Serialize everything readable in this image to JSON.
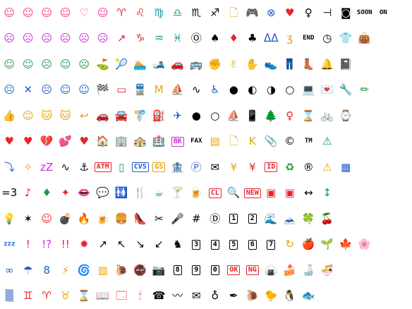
{
  "grid": {
    "cols": 22,
    "rows": 12,
    "icons": [
      {
        "glyph": "☺",
        "color": "#ff2d8e"
      },
      {
        "glyph": "☺",
        "color": "#ff2d8e"
      },
      {
        "glyph": "☺",
        "color": "#ff2d8e"
      },
      {
        "glyph": "☺",
        "color": "#ff2d8e"
      },
      {
        "glyph": "♡",
        "color": "#ff2d8e"
      },
      {
        "glyph": "☺",
        "color": "#ff2d8e"
      },
      {
        "glyph": "♈",
        "color": "#e5242b"
      },
      {
        "glyph": "♌",
        "color": "#e5242b"
      },
      {
        "glyph": "♍",
        "color": "#1a9a9a"
      },
      {
        "glyph": "♎",
        "color": "#1a9a9a"
      },
      {
        "glyph": "♏",
        "color": "#000000"
      },
      {
        "glyph": "♐",
        "color": "#000000"
      },
      {
        "glyph": "🗋",
        "color": "#e8a400"
      },
      {
        "glyph": "🎮",
        "color": "#000000"
      },
      {
        "glyph": "⊗",
        "color": "#1f5cc9"
      },
      {
        "glyph": "♥",
        "color": "#e5242b"
      },
      {
        "glyph": "♀",
        "color": "#000000"
      },
      {
        "glyph": "⊣",
        "color": "#000000"
      },
      {
        "glyph": "◙",
        "color": "#000000"
      },
      {
        "glyph": "SOON",
        "color": "#000000",
        "kind": "small"
      },
      {
        "glyph": "ON",
        "color": "#000000",
        "kind": "small"
      },
      {
        "glyph": "",
        "color": "#000000"
      },
      {
        "glyph": "☹",
        "color": "#c42fd6"
      },
      {
        "glyph": "☹",
        "color": "#c42fd6"
      },
      {
        "glyph": "☹",
        "color": "#c42fd6"
      },
      {
        "glyph": "☹",
        "color": "#c42fd6"
      },
      {
        "glyph": "☹",
        "color": "#c42fd6"
      },
      {
        "glyph": "☹",
        "color": "#c42fd6"
      },
      {
        "glyph": "↗",
        "color": "#e5242b"
      },
      {
        "glyph": "♑",
        "color": "#e5242b"
      },
      {
        "glyph": "♒",
        "color": "#1a9a9a"
      },
      {
        "glyph": "♓",
        "color": "#1a9a9a"
      },
      {
        "glyph": "Ⓞ",
        "color": "#000000"
      },
      {
        "glyph": "♠",
        "color": "#000000"
      },
      {
        "glyph": "♦",
        "color": "#e5242b"
      },
      {
        "glyph": "♣",
        "color": "#000000"
      },
      {
        "glyph": "ᐃᐃ",
        "color": "#1f5cc9"
      },
      {
        "glyph": "ʒ",
        "color": "#e8a400"
      },
      {
        "glyph": "END",
        "color": "#000000",
        "kind": "small"
      },
      {
        "glyph": "◷",
        "color": "#000000"
      },
      {
        "glyph": "👕",
        "color": "#1f5cc9"
      },
      {
        "glyph": "👜",
        "color": "#000000"
      },
      {
        "glyph": "",
        "color": "#000000"
      },
      {
        "glyph": "",
        "color": "#000000"
      },
      {
        "glyph": "☺",
        "color": "#1a9a40"
      },
      {
        "glyph": "☺",
        "color": "#1a9a40"
      },
      {
        "glyph": "☹",
        "color": "#1a9a40"
      },
      {
        "glyph": "☺",
        "color": "#1a9a40"
      },
      {
        "glyph": "☹",
        "color": "#1a9a40"
      },
      {
        "glyph": "⛳",
        "color": "#1a9a40"
      },
      {
        "glyph": "🎾",
        "color": "#1a9a40"
      },
      {
        "glyph": "🏊",
        "color": "#1f5cc9"
      },
      {
        "glyph": "🎿",
        "color": "#000000"
      },
      {
        "glyph": "🚗",
        "color": "#e8a400"
      },
      {
        "glyph": "🚌",
        "color": "#1f5cc9"
      },
      {
        "glyph": "✊",
        "color": "#e8a400"
      },
      {
        "glyph": "✌",
        "color": "#e8a400"
      },
      {
        "glyph": "✋",
        "color": "#e8a400"
      },
      {
        "glyph": "👟",
        "color": "#000000"
      },
      {
        "glyph": "👖",
        "color": "#1f5cc9"
      },
      {
        "glyph": "👢",
        "color": "#1f5cc9"
      },
      {
        "glyph": "🔔",
        "color": "#e8a400"
      },
      {
        "glyph": "📓",
        "color": "#e5242b"
      },
      {
        "glyph": "",
        "color": "#000000"
      },
      {
        "glyph": "",
        "color": "#000000"
      },
      {
        "glyph": "",
        "color": "#000000"
      },
      {
        "glyph": "☹",
        "color": "#1f5cc9"
      },
      {
        "glyph": "✕",
        "color": "#1f5cc9"
      },
      {
        "glyph": "☹",
        "color": "#1f5cc9"
      },
      {
        "glyph": "☺",
        "color": "#1f5cc9"
      },
      {
        "glyph": "☺",
        "color": "#1f5cc9"
      },
      {
        "glyph": "🏁",
        "color": "#000000"
      },
      {
        "glyph": "▭",
        "color": "#e5242b"
      },
      {
        "glyph": "🚆",
        "color": "#1a9a40"
      },
      {
        "glyph": "M",
        "color": "#e8a400"
      },
      {
        "glyph": "⛵",
        "color": "#1f5cc9"
      },
      {
        "glyph": "∿",
        "color": "#000000"
      },
      {
        "glyph": "♿",
        "color": "#1f5cc9"
      },
      {
        "glyph": "●",
        "color": "#000000"
      },
      {
        "glyph": "◐",
        "color": "#000000"
      },
      {
        "glyph": "◑",
        "color": "#000000"
      },
      {
        "glyph": "○",
        "color": "#000000"
      },
      {
        "glyph": "💻",
        "color": "#000000"
      },
      {
        "glyph": "💌",
        "color": "#e5242b"
      },
      {
        "glyph": "🔧",
        "color": "#1f5cc9"
      },
      {
        "glyph": "✏",
        "color": "#1a9a40"
      },
      {
        "glyph": "",
        "color": "#000000"
      },
      {
        "glyph": "",
        "color": "#000000"
      },
      {
        "glyph": "👍",
        "color": "#e8a400"
      },
      {
        "glyph": "☺",
        "color": "#e8a400"
      },
      {
        "glyph": "🐱",
        "color": "#e8a400"
      },
      {
        "glyph": "🐱",
        "color": "#e8a400"
      },
      {
        "glyph": "↩",
        "color": "#e8a400"
      },
      {
        "glyph": "🚗",
        "color": "#000000"
      },
      {
        "glyph": "🚘",
        "color": "#1a9a40"
      },
      {
        "glyph": "🚏",
        "color": "#e5242b"
      },
      {
        "glyph": "⛽",
        "color": "#1f5cc9"
      },
      {
        "glyph": "✈",
        "color": "#1f5cc9"
      },
      {
        "glyph": "●",
        "color": "#000000"
      },
      {
        "glyph": "○",
        "color": "#000000"
      },
      {
        "glyph": "⛵",
        "color": "#1f5cc9"
      },
      {
        "glyph": "📱",
        "color": "#000000"
      },
      {
        "glyph": "🌲",
        "color": "#1a9a40"
      },
      {
        "glyph": "♀",
        "color": "#e5242b"
      },
      {
        "glyph": "⌛",
        "color": "#000000"
      },
      {
        "glyph": "🚲",
        "color": "#000000"
      },
      {
        "glyph": "⌚",
        "color": "#1a9a40"
      },
      {
        "glyph": "",
        "color": "#000000"
      },
      {
        "glyph": "",
        "color": "#000000"
      },
      {
        "glyph": "",
        "color": "#000000"
      },
      {
        "glyph": "♥",
        "color": "#e5242b"
      },
      {
        "glyph": "♥",
        "color": "#e5242b"
      },
      {
        "glyph": "💔",
        "color": "#e5242b"
      },
      {
        "glyph": "💕",
        "color": "#e5242b"
      },
      {
        "glyph": "♥",
        "color": "#e5242b"
      },
      {
        "glyph": "🏠",
        "color": "#e5242b"
      },
      {
        "glyph": "🏢",
        "color": "#1f5cc9"
      },
      {
        "glyph": "🏤",
        "color": "#e5242b"
      },
      {
        "glyph": "🏥",
        "color": "#e5242b"
      },
      {
        "glyph": "BK",
        "color": "#c42fd6",
        "kind": "boxed"
      },
      {
        "glyph": "FAX",
        "color": "#000000",
        "kind": "small"
      },
      {
        "glyph": "▤",
        "color": "#e8a400"
      },
      {
        "glyph": "🗋",
        "color": "#e8a400"
      },
      {
        "glyph": "K",
        "color": "#e8a400"
      },
      {
        "glyph": "📎",
        "color": "#000000"
      },
      {
        "glyph": "©",
        "color": "#000000"
      },
      {
        "glyph": "TM",
        "color": "#000000",
        "kind": "small"
      },
      {
        "glyph": "⚠",
        "color": "#1a9a40"
      },
      {
        "glyph": "",
        "color": "#000000"
      },
      {
        "glyph": "",
        "color": "#000000"
      },
      {
        "glyph": "",
        "color": "#000000"
      },
      {
        "glyph": "",
        "color": "#000000"
      },
      {
        "glyph": "⤵",
        "color": "#1f5cc9"
      },
      {
        "glyph": "✧",
        "color": "#e8a400"
      },
      {
        "glyph": "zZ",
        "color": "#c42fd6"
      },
      {
        "glyph": "∿",
        "color": "#000000"
      },
      {
        "glyph": "⚓",
        "color": "#000000"
      },
      {
        "glyph": "ATM",
        "color": "#e5242b",
        "kind": "boxed"
      },
      {
        "glyph": "▯",
        "color": "#1a9a40"
      },
      {
        "glyph": "CVS",
        "color": "#1f5cc9",
        "kind": "boxed"
      },
      {
        "glyph": "GS",
        "color": "#e8a400",
        "kind": "boxed"
      },
      {
        "glyph": "🏦",
        "color": "#e5242b"
      },
      {
        "glyph": "Ⓟ",
        "color": "#1f5cc9"
      },
      {
        "glyph": "✉",
        "color": "#000000"
      },
      {
        "glyph": "¥",
        "color": "#e8a400"
      },
      {
        "glyph": "¥",
        "color": "#e5242b"
      },
      {
        "glyph": "ID",
        "color": "#e5242b",
        "kind": "boxed"
      },
      {
        "glyph": "♻",
        "color": "#1a9a40"
      },
      {
        "glyph": "®",
        "color": "#000000"
      },
      {
        "glyph": "⚠",
        "color": "#e8a400"
      },
      {
        "glyph": "▦",
        "color": "#1f5cc9"
      },
      {
        "glyph": "",
        "color": "#000000"
      },
      {
        "glyph": "",
        "color": "#000000"
      },
      {
        "glyph": "",
        "color": "#000000"
      },
      {
        "glyph": "=3",
        "color": "#000000"
      },
      {
        "glyph": "♪",
        "color": "#e5242b"
      },
      {
        "glyph": "♦",
        "color": "#1a9a40"
      },
      {
        "glyph": "✦",
        "color": "#e5242b"
      },
      {
        "glyph": "👄",
        "color": "#e5242b"
      },
      {
        "glyph": "💬",
        "color": "#000000"
      },
      {
        "glyph": "🚻",
        "color": "#000000"
      },
      {
        "glyph": "🍴",
        "color": "#000000"
      },
      {
        "glyph": "☕",
        "color": "#1a9a40"
      },
      {
        "glyph": "🍸",
        "color": "#c42fd6"
      },
      {
        "glyph": "🍺",
        "color": "#000000"
      },
      {
        "glyph": "CL",
        "color": "#e5242b",
        "kind": "boxed"
      },
      {
        "glyph": "🔍",
        "color": "#e8a400"
      },
      {
        "glyph": "NEW",
        "color": "#e5242b",
        "kind": "boxed"
      },
      {
        "glyph": "▣",
        "color": "#e5242b"
      },
      {
        "glyph": "▣",
        "color": "#e5242b"
      },
      {
        "glyph": "↔",
        "color": "#000000"
      },
      {
        "glyph": "↕",
        "color": "#1a9a40"
      },
      {
        "glyph": "",
        "color": "#000000"
      },
      {
        "glyph": "",
        "color": "#000000"
      },
      {
        "glyph": "",
        "color": "#000000"
      },
      {
        "glyph": "",
        "color": "#000000"
      },
      {
        "glyph": "💡",
        "color": "#e8a400"
      },
      {
        "glyph": "✶",
        "color": "#000000"
      },
      {
        "glyph": "☺",
        "color": "#e5242b"
      },
      {
        "glyph": "💣",
        "color": "#000000"
      },
      {
        "glyph": "🔥",
        "color": "#e5242b"
      },
      {
        "glyph": "🍺",
        "color": "#e8a400"
      },
      {
        "glyph": "🍔",
        "color": "#e8a400"
      },
      {
        "glyph": "👠",
        "color": "#e8a400"
      },
      {
        "glyph": "✂",
        "color": "#000000"
      },
      {
        "glyph": "🎤",
        "color": "#000000"
      },
      {
        "glyph": "#",
        "color": "#000000"
      },
      {
        "glyph": "Ⓓ",
        "color": "#000000"
      },
      {
        "glyph": "1",
        "color": "#000000",
        "kind": "boxed"
      },
      {
        "glyph": "2",
        "color": "#000000",
        "kind": "boxed"
      },
      {
        "glyph": "🌊",
        "color": "#1f5cc9"
      },
      {
        "glyph": "🗻",
        "color": "#1f5cc9"
      },
      {
        "glyph": "🍀",
        "color": "#1a9a40"
      },
      {
        "glyph": "🍒",
        "color": "#e5242b"
      },
      {
        "glyph": "",
        "color": "#000000"
      },
      {
        "glyph": "",
        "color": "#000000"
      },
      {
        "glyph": "",
        "color": "#000000"
      },
      {
        "glyph": "",
        "color": "#000000"
      },
      {
        "glyph": "zzz",
        "color": "#1f5cc9",
        "kind": "small"
      },
      {
        "glyph": "!",
        "color": "#e5242b"
      },
      {
        "glyph": "!?",
        "color": "#c42fd6"
      },
      {
        "glyph": "!!",
        "color": "#e5242b"
      },
      {
        "glyph": "✹",
        "color": "#e5242b"
      },
      {
        "glyph": "↗",
        "color": "#000000"
      },
      {
        "glyph": "↖",
        "color": "#000000"
      },
      {
        "glyph": "↘",
        "color": "#000000"
      },
      {
        "glyph": "↙",
        "color": "#000000"
      },
      {
        "glyph": "♞",
        "color": "#000000"
      },
      {
        "glyph": "3",
        "color": "#000000",
        "kind": "boxed"
      },
      {
        "glyph": "4",
        "color": "#000000",
        "kind": "boxed"
      },
      {
        "glyph": "5",
        "color": "#000000",
        "kind": "boxed"
      },
      {
        "glyph": "6",
        "color": "#000000",
        "kind": "boxed"
      },
      {
        "glyph": "7",
        "color": "#000000",
        "kind": "boxed"
      },
      {
        "glyph": "↻",
        "color": "#e8a400"
      },
      {
        "glyph": "🍎",
        "color": "#e5242b"
      },
      {
        "glyph": "🌱",
        "color": "#1a9a40"
      },
      {
        "glyph": "🍁",
        "color": "#e5242b"
      },
      {
        "glyph": "🌸",
        "color": "#e5242b"
      },
      {
        "glyph": "",
        "color": "#000000"
      },
      {
        "glyph": "",
        "color": "#000000"
      },
      {
        "glyph": "∞",
        "color": "#1f5cc9"
      },
      {
        "glyph": "☂",
        "color": "#1f5cc9"
      },
      {
        "glyph": "8",
        "color": "#1f5cc9"
      },
      {
        "glyph": "⚡",
        "color": "#e8a400"
      },
      {
        "glyph": "🌀",
        "color": "#e5242b"
      },
      {
        "glyph": "▥",
        "color": "#e8a400"
      },
      {
        "glyph": "🐌",
        "color": "#1f5cc9"
      },
      {
        "glyph": "🚭",
        "color": "#e5242b"
      },
      {
        "glyph": "📷",
        "color": "#000000"
      },
      {
        "glyph": "8",
        "color": "#000000",
        "kind": "boxed"
      },
      {
        "glyph": "9",
        "color": "#000000",
        "kind": "boxed"
      },
      {
        "glyph": "0",
        "color": "#000000",
        "kind": "boxed"
      },
      {
        "glyph": "OK",
        "color": "#e5242b",
        "kind": "boxed"
      },
      {
        "glyph": "NG",
        "color": "#e5242b",
        "kind": "boxed"
      },
      {
        "glyph": "🍙",
        "color": "#000000"
      },
      {
        "glyph": "🍰",
        "color": "#e5242b"
      },
      {
        "glyph": "🍶",
        "color": "#e5242b"
      },
      {
        "glyph": "🍜",
        "color": "#e8a400"
      },
      {
        "glyph": "",
        "color": "#000000"
      },
      {
        "glyph": "",
        "color": "#000000"
      },
      {
        "glyph": "",
        "color": "#000000"
      },
      {
        "glyph": "",
        "color": "#000000"
      },
      {
        "glyph": "▒",
        "color": "#1f5cc9"
      },
      {
        "glyph": "♊",
        "color": "#e5242b"
      },
      {
        "glyph": "♈",
        "color": "#e5242b"
      },
      {
        "glyph": "♉",
        "color": "#e8a400"
      },
      {
        "glyph": "⌛",
        "color": "#000000"
      },
      {
        "glyph": "📖",
        "color": "#e8a400"
      },
      {
        "glyph": "🗔",
        "color": "#e5242b"
      },
      {
        "glyph": "🕯",
        "color": "#e5242b"
      },
      {
        "glyph": "☎",
        "color": "#000000"
      },
      {
        "glyph": "〰",
        "color": "#000000"
      },
      {
        "glyph": "✉",
        "color": "#000000"
      },
      {
        "glyph": "♁",
        "color": "#000000"
      },
      {
        "glyph": "✒",
        "color": "#000000"
      },
      {
        "glyph": "🐌",
        "color": "#e8a400"
      },
      {
        "glyph": "🐤",
        "color": "#e8a400"
      },
      {
        "glyph": "🐧",
        "color": "#1f5cc9"
      },
      {
        "glyph": "🐟",
        "color": "#1f5cc9"
      },
      {
        "glyph": "",
        "color": "#000000"
      },
      {
        "glyph": "",
        "color": "#000000"
      },
      {
        "glyph": "",
        "color": "#000000"
      },
      {
        "glyph": "",
        "color": "#000000"
      },
      {
        "glyph": "",
        "color": "#000000"
      }
    ]
  }
}
